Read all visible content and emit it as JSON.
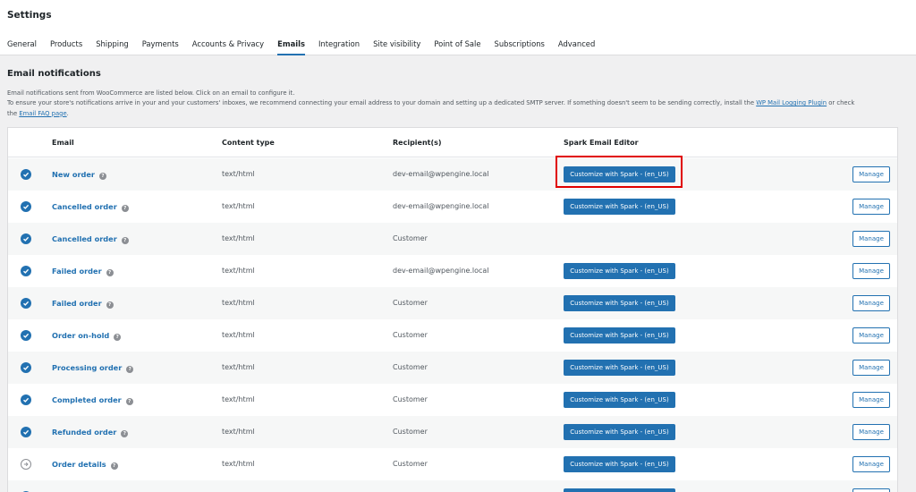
{
  "header": {
    "title": "Settings",
    "tabs": [
      "General",
      "Products",
      "Shipping",
      "Payments",
      "Accounts & Privacy",
      "Emails",
      "Integration",
      "Site visibility",
      "Point of Sale",
      "Subscriptions",
      "Advanced"
    ],
    "active_tab": "Emails"
  },
  "section": {
    "title": "Email notifications",
    "desc_line1": "Email notifications sent from WooCommerce are listed below. Click on an email to configure it.",
    "desc_line2_pre": "To ensure your store's notifications arrive in your and your customers' inboxes, we recommend connecting your email address to your domain and setting up a dedicated SMTP server. If something doesn't seem to be sending correctly, install the ",
    "desc_link1": "WP Mail Logging Plugin",
    "desc_mid": " or check",
    "desc_line3_pre": "the ",
    "desc_link2": "Email FAQ page",
    "desc_end": "."
  },
  "table": {
    "columns": [
      "Email",
      "Content type",
      "Recipient(s)",
      "Spark Email Editor"
    ],
    "rows": [
      {
        "name": "New order",
        "content_type": "text/html",
        "recipient": "dev-email@wpengine.local",
        "spark": "Customize with Spark - (en_US)",
        "action": "Manage",
        "status": "enabled"
      },
      {
        "name": "Cancelled order",
        "content_type": "text/html",
        "recipient": "dev-email@wpengine.local",
        "spark": "Customize with Spark - (en_US)",
        "action": "Manage",
        "status": "enabled"
      },
      {
        "name": "Cancelled order",
        "content_type": "text/html",
        "recipient": "Customer",
        "spark": "",
        "action": "Manage",
        "status": "enabled"
      },
      {
        "name": "Failed order",
        "content_type": "text/html",
        "recipient": "dev-email@wpengine.local",
        "spark": "Customize with Spark - (en_US)",
        "action": "Manage",
        "status": "enabled"
      },
      {
        "name": "Failed order",
        "content_type": "text/html",
        "recipient": "Customer",
        "spark": "Customize with Spark - (en_US)",
        "action": "Manage",
        "status": "enabled"
      },
      {
        "name": "Order on-hold",
        "content_type": "text/html",
        "recipient": "Customer",
        "spark": "Customize with Spark - (en_US)",
        "action": "Manage",
        "status": "enabled"
      },
      {
        "name": "Processing order",
        "content_type": "text/html",
        "recipient": "Customer",
        "spark": "Customize with Spark - (en_US)",
        "action": "Manage",
        "status": "enabled"
      },
      {
        "name": "Completed order",
        "content_type": "text/html",
        "recipient": "Customer",
        "spark": "Customize with Spark - (en_US)",
        "action": "Manage",
        "status": "enabled"
      },
      {
        "name": "Refunded order",
        "content_type": "text/html",
        "recipient": "Customer",
        "spark": "Customize with Spark - (en_US)",
        "action": "Manage",
        "status": "enabled"
      },
      {
        "name": "Order details",
        "content_type": "text/html",
        "recipient": "Customer",
        "spark": "Customize with Spark - (en_US)",
        "action": "Manage",
        "status": "manual"
      },
      {
        "name": "",
        "content_type": "",
        "recipient": "",
        "spark": "",
        "action": "",
        "status": "enabled"
      }
    ]
  },
  "colors": {
    "accent": "#2271b1",
    "highlight": "#e00000",
    "background": "#f0f0f1"
  },
  "icons": {
    "enabled": "check-circle-icon",
    "manual": "arrow-right-circle-icon",
    "help": "help-icon"
  }
}
